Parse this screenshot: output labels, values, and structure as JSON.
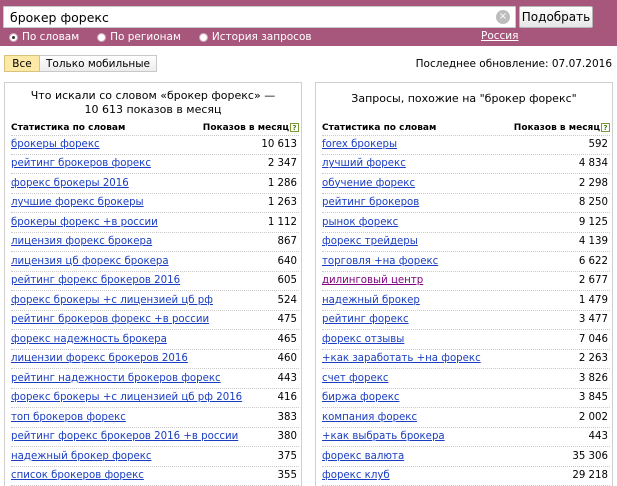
{
  "search": {
    "query": "брокер форекс",
    "button_label": "Подобрать",
    "modes": [
      "По словам",
      "По регионам",
      "История запросов"
    ],
    "region": "Россия"
  },
  "filters": {
    "all": "Все",
    "mobile": "Только мобильные"
  },
  "updated": "Последнее обновление: 07.07.2016",
  "left": {
    "title": "Что искали со словом «брокер форекс» — 10 613 показов в месяц",
    "col_phrase": "Статистика по словам",
    "col_count": "Показов в месяц",
    "rows": [
      {
        "phrase": "брокеры форекс",
        "count": "10 613"
      },
      {
        "phrase": "рейтинг брокеров форекс",
        "count": "2 347"
      },
      {
        "phrase": "форекс брокеры 2016",
        "count": "1 286"
      },
      {
        "phrase": "лучшие форекс брокеры",
        "count": "1 263"
      },
      {
        "phrase": "брокеры форекс +в россии",
        "count": "1 112"
      },
      {
        "phrase": "лицензия форекс брокера",
        "count": "867"
      },
      {
        "phrase": "лицензия цб форекс брокера",
        "count": "640"
      },
      {
        "phrase": "рейтинг форекс брокеров 2016",
        "count": "605"
      },
      {
        "phrase": "форекс брокеры +с лицензией цб рф",
        "count": "524"
      },
      {
        "phrase": "рейтинг брокеров форекс +в россии",
        "count": "475"
      },
      {
        "phrase": "форекс надежность брокера",
        "count": "465"
      },
      {
        "phrase": "лицензии форекс брокеров 2016",
        "count": "460"
      },
      {
        "phrase": "рейтинг надежности брокеров форекс",
        "count": "443"
      },
      {
        "phrase": "форекс брокеры +с лицензией цб рф 2016",
        "count": "416"
      },
      {
        "phrase": "топ брокеров форекс",
        "count": "383"
      },
      {
        "phrase": "рейтинг форекс брокеров 2016 +в россии",
        "count": "380"
      },
      {
        "phrase": "надежный брокер форекс",
        "count": "375"
      },
      {
        "phrase": "список брокеров форекс",
        "count": "355"
      }
    ]
  },
  "right": {
    "title": "Запросы, похожие на \"брокер форекс\"",
    "col_phrase": "Статистика по словам",
    "col_count": "Показов в месяц",
    "rows": [
      {
        "phrase": "forex брокеры",
        "count": "592"
      },
      {
        "phrase": "лучший форекс",
        "count": "4 834"
      },
      {
        "phrase": "обучение форекс",
        "count": "2 298"
      },
      {
        "phrase": "рейтинг брокеров",
        "count": "8 250"
      },
      {
        "phrase": "рынок форекс",
        "count": "9 125"
      },
      {
        "phrase": "форекс трейдеры",
        "count": "4 139"
      },
      {
        "phrase": "торговля +на форекс",
        "count": "6 622"
      },
      {
        "phrase": "дилинговый центр",
        "count": "2 677",
        "visited": true
      },
      {
        "phrase": "надежный брокер",
        "count": "1 479"
      },
      {
        "phrase": "рейтинг форекс",
        "count": "3 477"
      },
      {
        "phrase": "форекс отзывы",
        "count": "7 046"
      },
      {
        "phrase": "+как заработать +на форекс",
        "count": "2 263"
      },
      {
        "phrase": "счет форекс",
        "count": "3 826"
      },
      {
        "phrase": "биржа форекс",
        "count": "3 845"
      },
      {
        "phrase": "компания форекс",
        "count": "2 002"
      },
      {
        "phrase": "+как выбрать брокера",
        "count": "443"
      },
      {
        "phrase": "форекс валюта",
        "count": "35 306"
      },
      {
        "phrase": "форекс клуб",
        "count": "29 218"
      }
    ]
  }
}
